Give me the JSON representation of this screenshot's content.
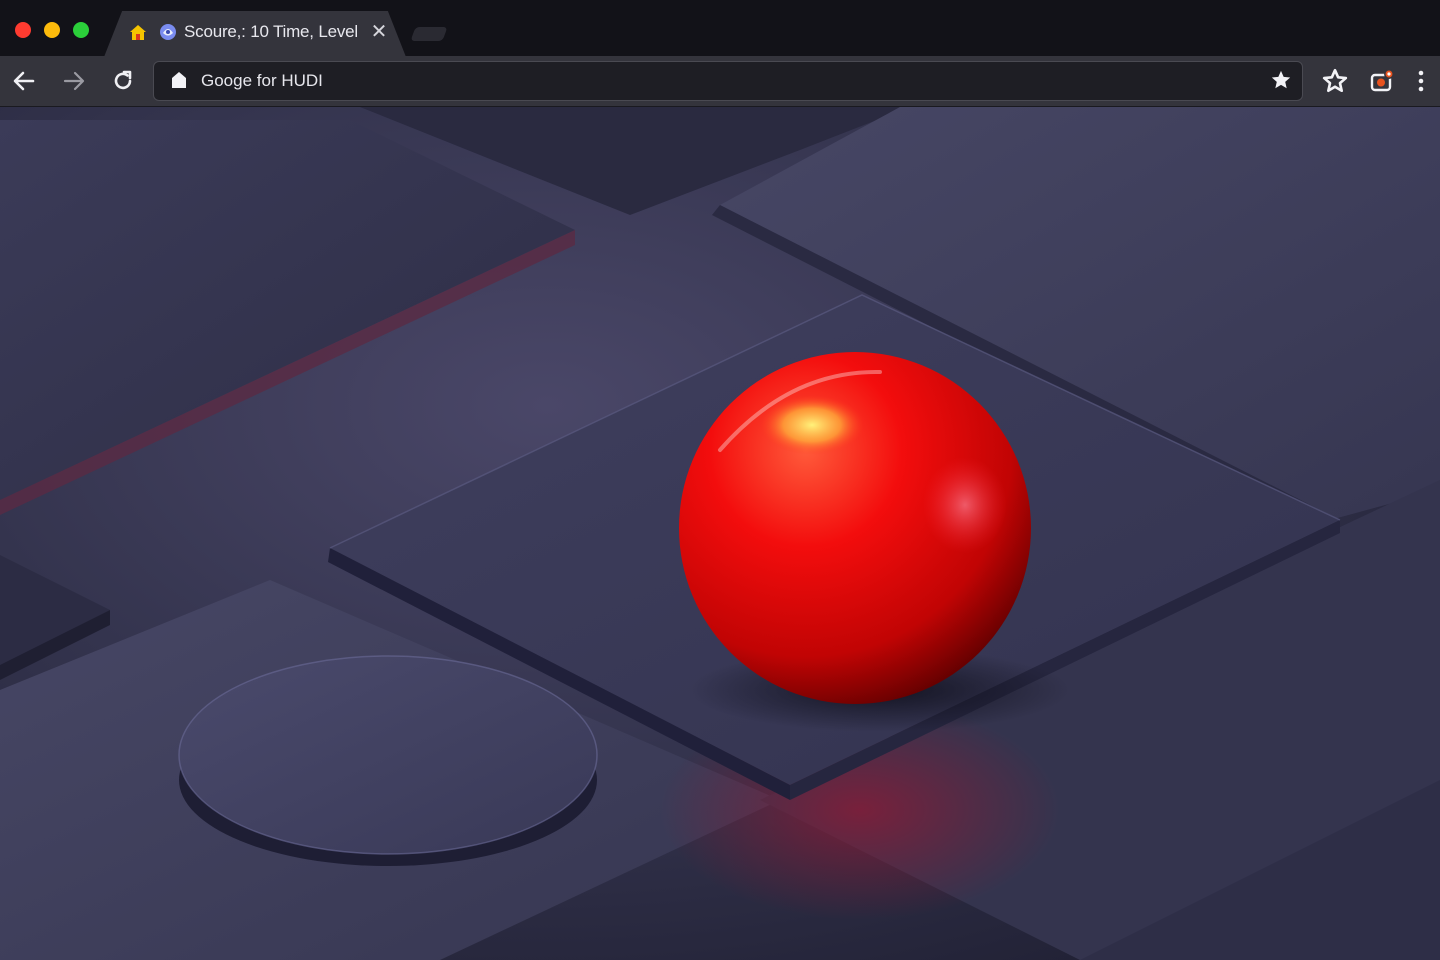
{
  "browser": {
    "tab": {
      "title": "Scoure,: 10 Time, Level",
      "close_glyph": "✕"
    },
    "address_bar": {
      "url": "Googe for HUDI"
    }
  },
  "icons": {
    "tab": [
      "home-icon",
      "game-icon"
    ],
    "toolbar": [
      "back-arrow-icon",
      "forward-arrow-icon",
      "reload-icon",
      "lock-icon",
      "bookmark-star-icon",
      "star-extension-icon",
      "camera-extension-icon",
      "more-menu-icon"
    ]
  },
  "game": {
    "scene": [
      "floor-tiles",
      "raised-square-platform",
      "round-pressure-pad",
      "red-ball"
    ]
  },
  "colors": {
    "ball": "#ee0a0a",
    "platform": "#3c3c5a",
    "background": "#2b2b42",
    "window_red": "#fe3b30",
    "window_yellow": "#fdbb0c",
    "window_green": "#2bcf3a"
  }
}
